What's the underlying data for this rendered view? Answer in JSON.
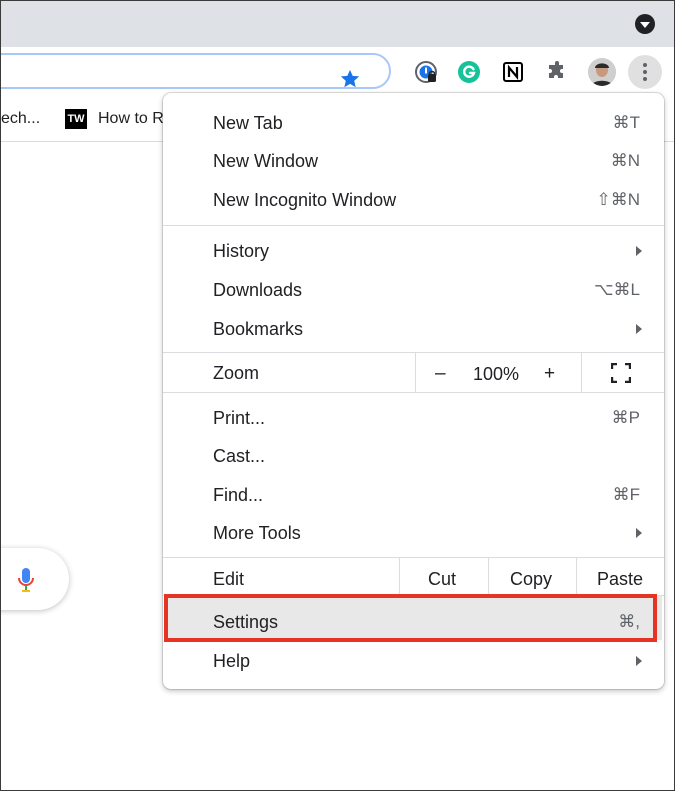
{
  "bookmarks": [
    {
      "label": "ech..."
    },
    {
      "icon_text": "TW",
      "label": "How to R"
    }
  ],
  "menu": {
    "group1": [
      {
        "label": "New Tab",
        "shortcut": "⌘T"
      },
      {
        "label": "New Window",
        "shortcut": "⌘N"
      },
      {
        "label": "New Incognito Window",
        "shortcut": "⇧⌘N"
      }
    ],
    "group2": [
      {
        "label": "History",
        "submenu": true
      },
      {
        "label": "Downloads",
        "shortcut": "⌥⌘L"
      },
      {
        "label": "Bookmarks",
        "submenu": true
      }
    ],
    "zoom": {
      "label": "Zoom",
      "minus": "–",
      "value": "100%",
      "plus": "+"
    },
    "group3": [
      {
        "label": "Print...",
        "shortcut": "⌘P"
      },
      {
        "label": "Cast..."
      },
      {
        "label": "Find...",
        "shortcut": "⌘F"
      },
      {
        "label": "More Tools",
        "submenu": true
      }
    ],
    "edit": {
      "label": "Edit",
      "cut": "Cut",
      "copy": "Copy",
      "paste": "Paste"
    },
    "settings": {
      "label": "Settings",
      "shortcut": "⌘,"
    },
    "help": {
      "label": "Help",
      "submenu": true
    }
  },
  "colors": {
    "highlight_border": "#e53324",
    "star": "#1a73e8",
    "grammarly": "#15c39a"
  },
  "icons": [
    "tab-search-icon",
    "bookmark-star-icon",
    "1password-extension-icon",
    "grammarly-extension-icon",
    "notion-extension-icon",
    "extensions-puzzle-icon",
    "profile-avatar",
    "three-dot-menu-icon",
    "microphone-icon",
    "fullscreen-icon"
  ]
}
